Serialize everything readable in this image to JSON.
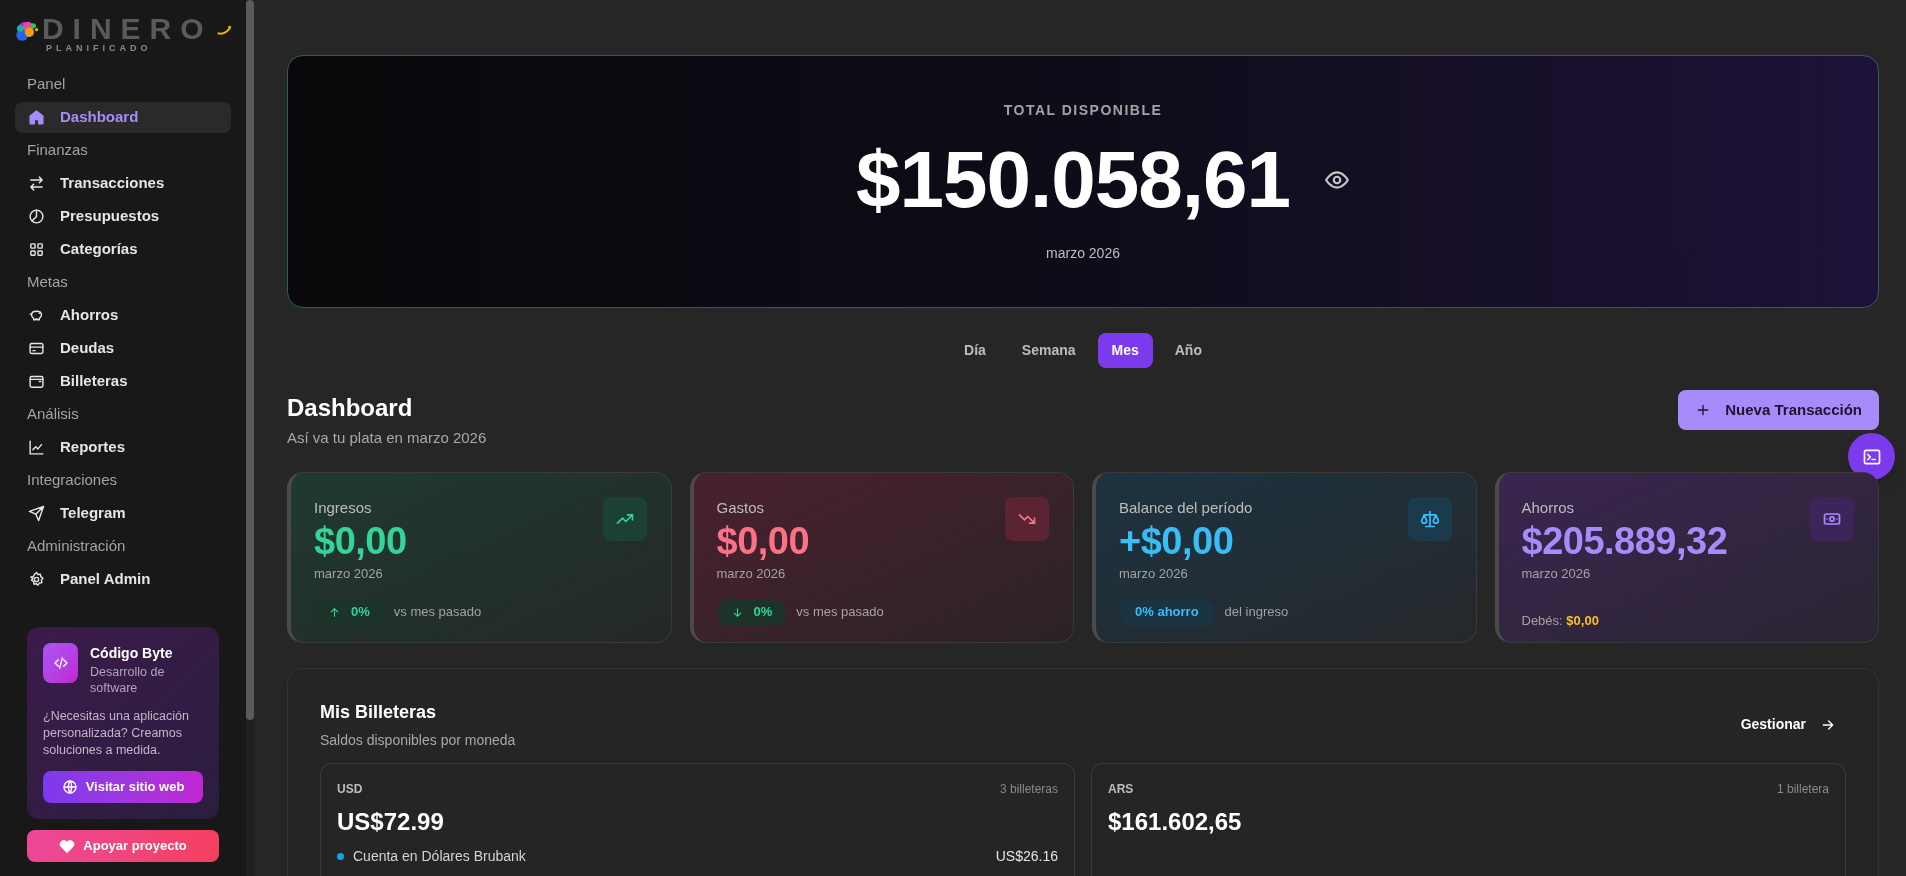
{
  "sidebar": {
    "logo": {
      "title": "DINERO",
      "subtitle": "PLANIFICADO"
    },
    "sections": [
      {
        "label": "Panel",
        "items": [
          {
            "label": "Dashboard",
            "selected": true
          }
        ]
      },
      {
        "label": "Finanzas",
        "items": [
          {
            "label": "Transacciones",
            "selected": false
          },
          {
            "label": "Presupuestos",
            "selected": false
          },
          {
            "label": "Categorías",
            "selected": false
          }
        ]
      },
      {
        "label": "Metas",
        "items": [
          {
            "label": "Ahorros",
            "selected": false
          },
          {
            "label": "Deudas",
            "selected": false
          },
          {
            "label": "Billeteras",
            "selected": false
          }
        ]
      },
      {
        "label": "Análisis",
        "items": [
          {
            "label": "Reportes",
            "selected": false
          }
        ]
      },
      {
        "label": "Integraciones",
        "items": [
          {
            "label": "Telegram",
            "selected": false
          }
        ]
      },
      {
        "label": "Administración",
        "items": [
          {
            "label": "Panel Admin",
            "selected": false
          }
        ]
      }
    ],
    "promo": {
      "title": "Código Byte",
      "subtitle": "Desarrollo de software",
      "text": "¿Necesitas una aplicación personalizada? Creamos soluciones a medida.",
      "button": "Visitar sitio web"
    },
    "support_button": "Apoyar proyecto"
  },
  "hero": {
    "label": "TOTAL DISPONIBLE",
    "amount": "$150.058,61",
    "date": "marzo 2026"
  },
  "period_tabs": [
    {
      "label": "Día",
      "selected": false
    },
    {
      "label": "Semana",
      "selected": false
    },
    {
      "label": "Mes",
      "selected": true
    },
    {
      "label": "Año",
      "selected": false
    }
  ],
  "header": {
    "title": "Dashboard",
    "subtitle": "Así va tu plata en marzo 2026",
    "new_button": "Nueva Transacción"
  },
  "stat_cards": [
    {
      "kind": "income",
      "label": "Ingresos",
      "value": "$0,00",
      "date": "marzo 2026",
      "color": "#34d399",
      "badge": "0%",
      "note": "vs mes pasado"
    },
    {
      "kind": "expense",
      "label": "Gastos",
      "value": "$0,00",
      "date": "marzo 2026",
      "color": "#fb7185",
      "badge": "0%",
      "note": "vs mes pasado"
    },
    {
      "kind": "balance",
      "label": "Balance del período",
      "value": "+$0,00",
      "date": "marzo 2026",
      "color": "#38bdf8",
      "badge": "0% ahorro",
      "note": "del ingreso"
    },
    {
      "kind": "savings",
      "label": "Ahorros",
      "value": "$205.889,32",
      "date": "marzo 2026",
      "color": "#a78bfa",
      "note": "Debés:",
      "debt": "$0,00"
    }
  ],
  "wallets": {
    "title": "Mis Billeteras",
    "subtitle": "Saldos disponibles por moneda",
    "manage_link": "Gestionar",
    "groups": [
      {
        "currency": "USD",
        "count": "3 billeteras",
        "total": "US$72.99",
        "accounts": [
          {
            "name": "Cuenta en Dólares Brubank",
            "amount": "US$26.16",
            "color": "#0ea5e9"
          }
        ]
      },
      {
        "currency": "ARS",
        "count": "1 billetera",
        "total": "$161.602,65"
      }
    ]
  }
}
